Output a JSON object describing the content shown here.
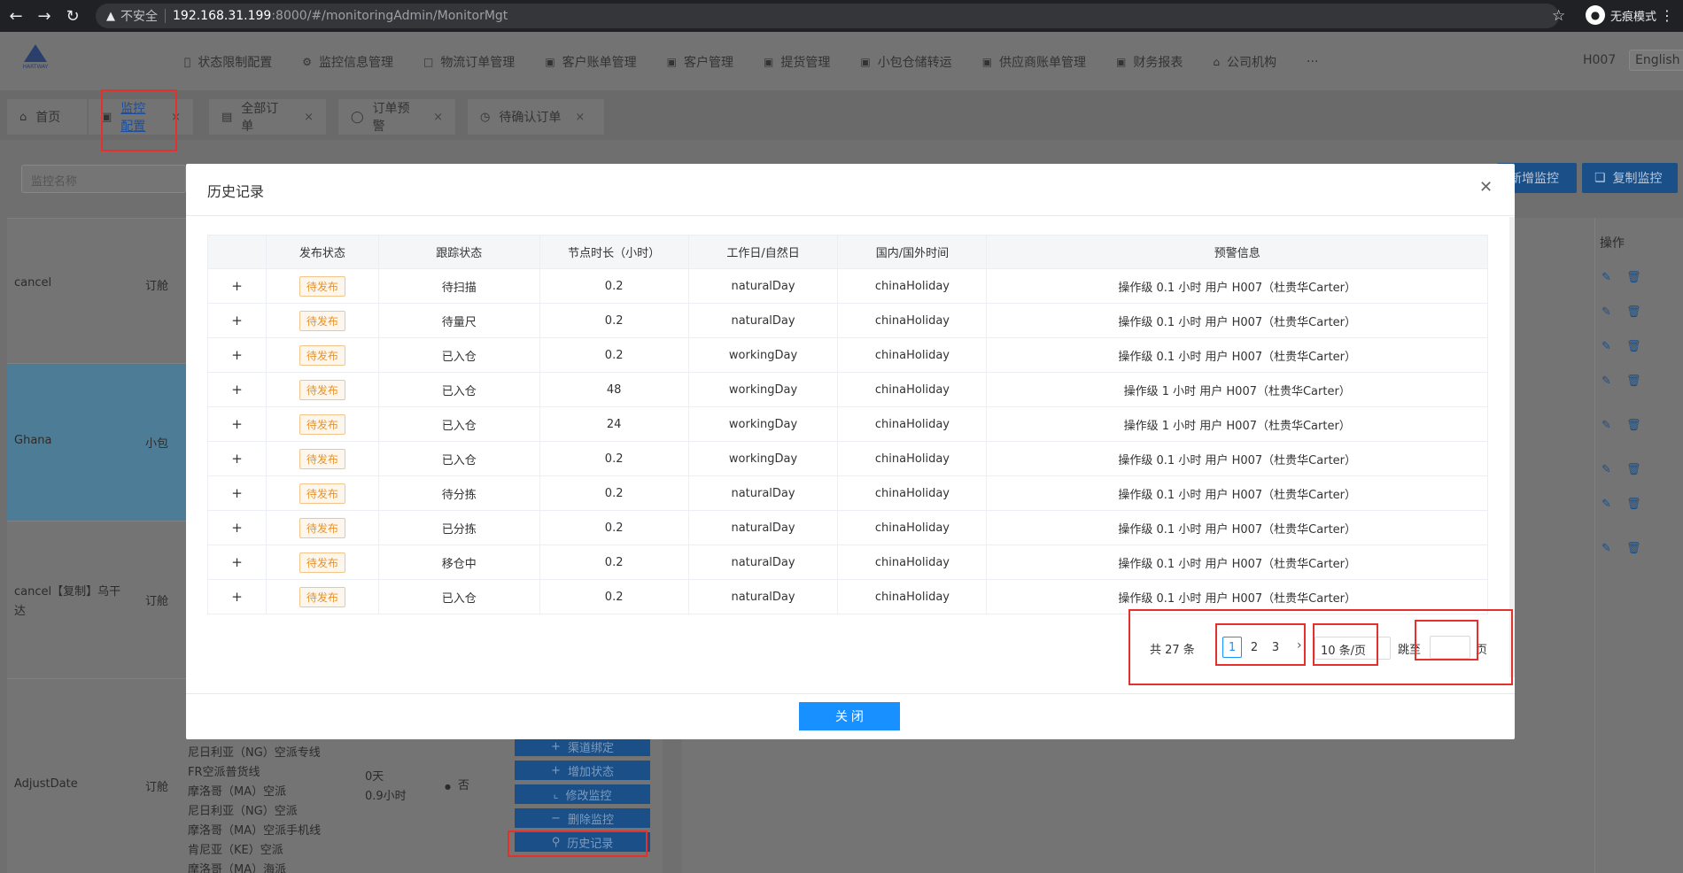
{
  "browser": {
    "insecure_label": "不安全",
    "url_host": "192.168.31.199",
    "url_path": ":8000/#/monitoringAdmin/MonitorMgt",
    "incognito_label": "无痕模式"
  },
  "header": {
    "menu": [
      {
        "icon": "status-icon",
        "label": "状态限制配置"
      },
      {
        "icon": "monitor-icon",
        "label": "监控信息管理"
      },
      {
        "icon": "doc-icon",
        "label": "物流订单管理"
      },
      {
        "icon": "bill-icon",
        "label": "客户账单管理"
      },
      {
        "icon": "customer-icon",
        "label": "客户管理"
      },
      {
        "icon": "truck-icon",
        "label": "提货管理"
      },
      {
        "icon": "package-icon",
        "label": "小包仓储转运"
      },
      {
        "icon": "supplier-icon",
        "label": "供应商账单管理"
      },
      {
        "icon": "chart-icon",
        "label": "财务报表"
      },
      {
        "icon": "bank-icon",
        "label": "公司机构"
      },
      {
        "icon": "",
        "label": "···"
      }
    ],
    "user": "H007",
    "lang": "English"
  },
  "tabs": [
    {
      "label": "首页"
    },
    {
      "label": "监控配置"
    },
    {
      "label": "全部订单"
    },
    {
      "label": "订单预警"
    },
    {
      "label": "待确认订单"
    }
  ],
  "background": {
    "filter_placeholder": "监控名称",
    "btn_add": "新增监控",
    "btn_copy": "复制监控",
    "op_header": "操作",
    "rows": [
      {
        "name": "cancel",
        "type": "订舱"
      },
      {
        "name": "Ghana",
        "type": "小包"
      },
      {
        "name": "cancel【复制】乌干达",
        "type": "订舱"
      },
      {
        "name": "AdjustDate",
        "type": "订舱"
      }
    ],
    "adjust_list": [
      "尼日利亚（NG）空派专线",
      "FR空派普货线",
      "摩洛哥（MA）空派",
      "尼日利亚（NG）空派",
      "摩洛哥（MA）空派手机线",
      "肯尼亚（KE）空派",
      "摩洛哥（MA）海派"
    ],
    "adjust_days": "0天",
    "adjust_hours": "0.9小时",
    "adjust_flag": "否",
    "actions": [
      "渠道绑定",
      "增加状态",
      "修改监控",
      "删除监控",
      "历史记录"
    ]
  },
  "modal": {
    "title": "历史记录",
    "columns": [
      "",
      "发布状态",
      "跟踪状态",
      "节点时长（小时）",
      "工作日/自然日",
      "国内/国外时间",
      "预警信息"
    ],
    "rows": [
      {
        "publish": "待发布",
        "track": "待扫描",
        "hours": "0.2",
        "daytype": "naturalDay",
        "holiday": "chinaHoliday",
        "alert": "操作级 0.1 小时 用户 H007（杜贵华Carter）"
      },
      {
        "publish": "待发布",
        "track": "待量尺",
        "hours": "0.2",
        "daytype": "naturalDay",
        "holiday": "chinaHoliday",
        "alert": "操作级 0.1 小时 用户 H007（杜贵华Carter）"
      },
      {
        "publish": "待发布",
        "track": "已入仓",
        "hours": "0.2",
        "daytype": "workingDay",
        "holiday": "chinaHoliday",
        "alert": "操作级 0.1 小时 用户 H007（杜贵华Carter）"
      },
      {
        "publish": "待发布",
        "track": "已入仓",
        "hours": "48",
        "daytype": "workingDay",
        "holiday": "chinaHoliday",
        "alert": "操作级 1 小时 用户 H007（杜贵华Carter）"
      },
      {
        "publish": "待发布",
        "track": "已入仓",
        "hours": "24",
        "daytype": "workingDay",
        "holiday": "chinaHoliday",
        "alert": "操作级 1 小时 用户 H007（杜贵华Carter）"
      },
      {
        "publish": "待发布",
        "track": "已入仓",
        "hours": "0.2",
        "daytype": "workingDay",
        "holiday": "chinaHoliday",
        "alert": "操作级 0.1 小时 用户 H007（杜贵华Carter）"
      },
      {
        "publish": "待发布",
        "track": "待分拣",
        "hours": "0.2",
        "daytype": "naturalDay",
        "holiday": "chinaHoliday",
        "alert": "操作级 0.1 小时 用户 H007（杜贵华Carter）"
      },
      {
        "publish": "待发布",
        "track": "已分拣",
        "hours": "0.2",
        "daytype": "naturalDay",
        "holiday": "chinaHoliday",
        "alert": "操作级 0.1 小时 用户 H007（杜贵华Carter）"
      },
      {
        "publish": "待发布",
        "track": "移仓中",
        "hours": "0.2",
        "daytype": "naturalDay",
        "holiday": "chinaHoliday",
        "alert": "操作级 0.1 小时 用户 H007（杜贵华Carter）"
      },
      {
        "publish": "待发布",
        "track": "已入仓",
        "hours": "0.2",
        "daytype": "naturalDay",
        "holiday": "chinaHoliday",
        "alert": "操作级 0.1 小时 用户 H007（杜贵华Carter）"
      }
    ],
    "pagination": {
      "total": "共 27 条",
      "pages": [
        "1",
        "2",
        "3"
      ],
      "current": "1",
      "page_size": "10 条/页",
      "jump_label": "跳至",
      "page_label": "页"
    },
    "close_label": "关 闭"
  },
  "colors": {
    "primary": "#1890ff",
    "annotation": "#e5312c",
    "badge_text": "#e8932c"
  }
}
